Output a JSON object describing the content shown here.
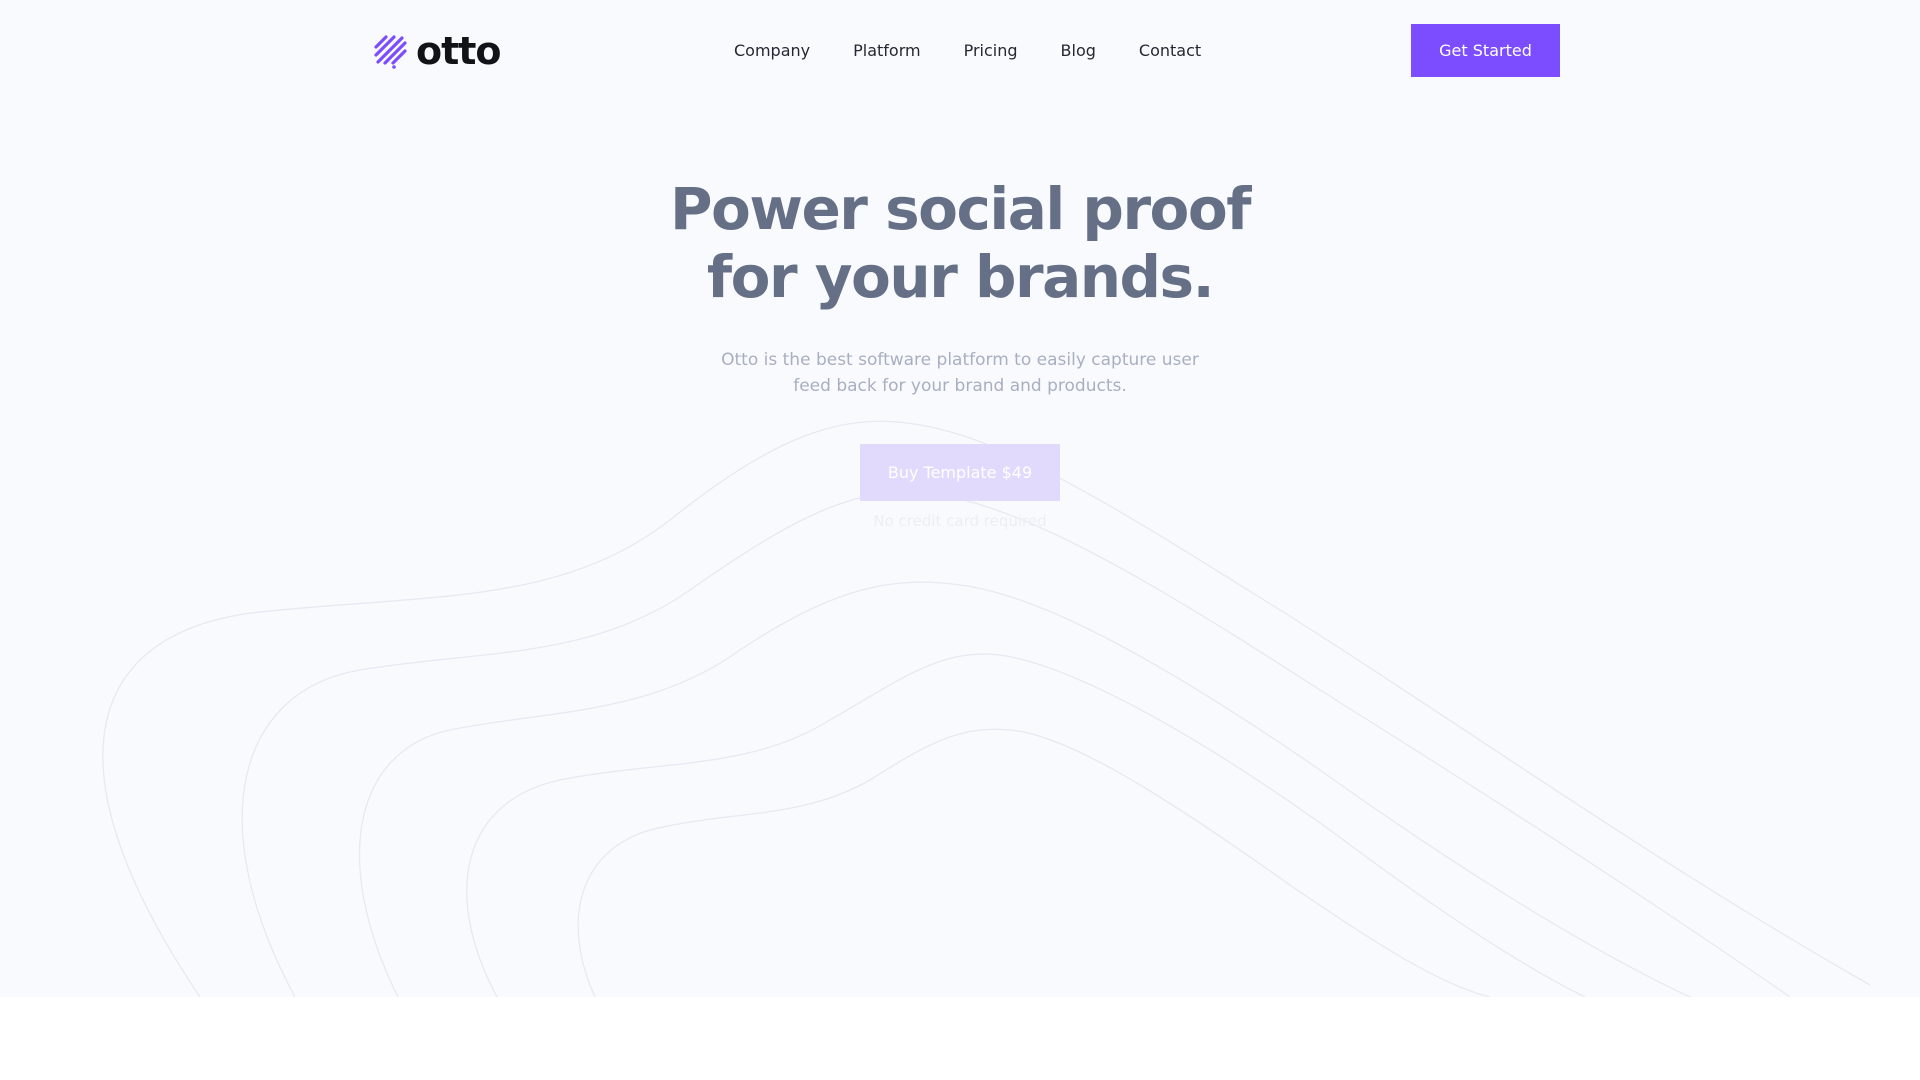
{
  "brand": {
    "name": "otto",
    "logo_icon": "stripes-logo-icon",
    "accent_color": "#7c4dff"
  },
  "nav": {
    "links": [
      {
        "label": "Company"
      },
      {
        "label": "Platform"
      },
      {
        "label": "Pricing"
      },
      {
        "label": "Blog"
      },
      {
        "label": "Contact"
      }
    ],
    "cta_label": "Get Started"
  },
  "hero": {
    "title_lines": [
      "Power social proof",
      "for your brands."
    ],
    "subtitle_lines": [
      "Otto is the best software platform to easily capture user",
      "feed back for your brand and products."
    ],
    "buy_button_label": "Buy Template $49",
    "note": "No credit card required",
    "background_decoration": "contour-lines"
  }
}
